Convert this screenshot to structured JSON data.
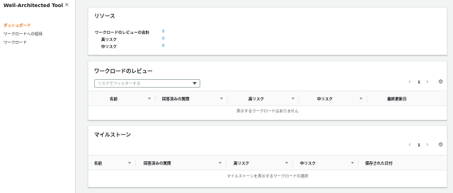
{
  "sidebar": {
    "title": "Well-Architected Tool",
    "close_glyph": "×",
    "items": [
      {
        "label": "ダッシュボード"
      },
      {
        "label": "ワークロードへの招待"
      },
      {
        "label": "ワークロード"
      }
    ]
  },
  "resources": {
    "title": "リソース",
    "rows": [
      {
        "label": "ワークロードのレビューの合計",
        "value": "0"
      },
      {
        "label": "高リスク",
        "value": "0"
      },
      {
        "label": "中リスク",
        "value": "0"
      }
    ]
  },
  "reviews": {
    "title": "ワークロードのレビュー",
    "filter_placeholder": "リスクでフィルターする",
    "page": "1",
    "columns": [
      "名前",
      "回答済みの質問",
      "高リスク",
      "中リスク",
      "最終更新日"
    ],
    "empty": "表示するワークロードはありません"
  },
  "milestones": {
    "title": "マイルストーン",
    "page": "1",
    "columns": [
      "名前",
      "回答済みの質問",
      "高リスク",
      "中リスク",
      "保存された日付"
    ],
    "empty": "マイルストーンを表示するワークロードの選択"
  },
  "glyphs": {
    "prev": "‹",
    "next": "›",
    "gear": "⚙"
  },
  "colors": {
    "accent": "#ec7211",
    "link": "#0073bb",
    "background": "#f2f3f3"
  }
}
